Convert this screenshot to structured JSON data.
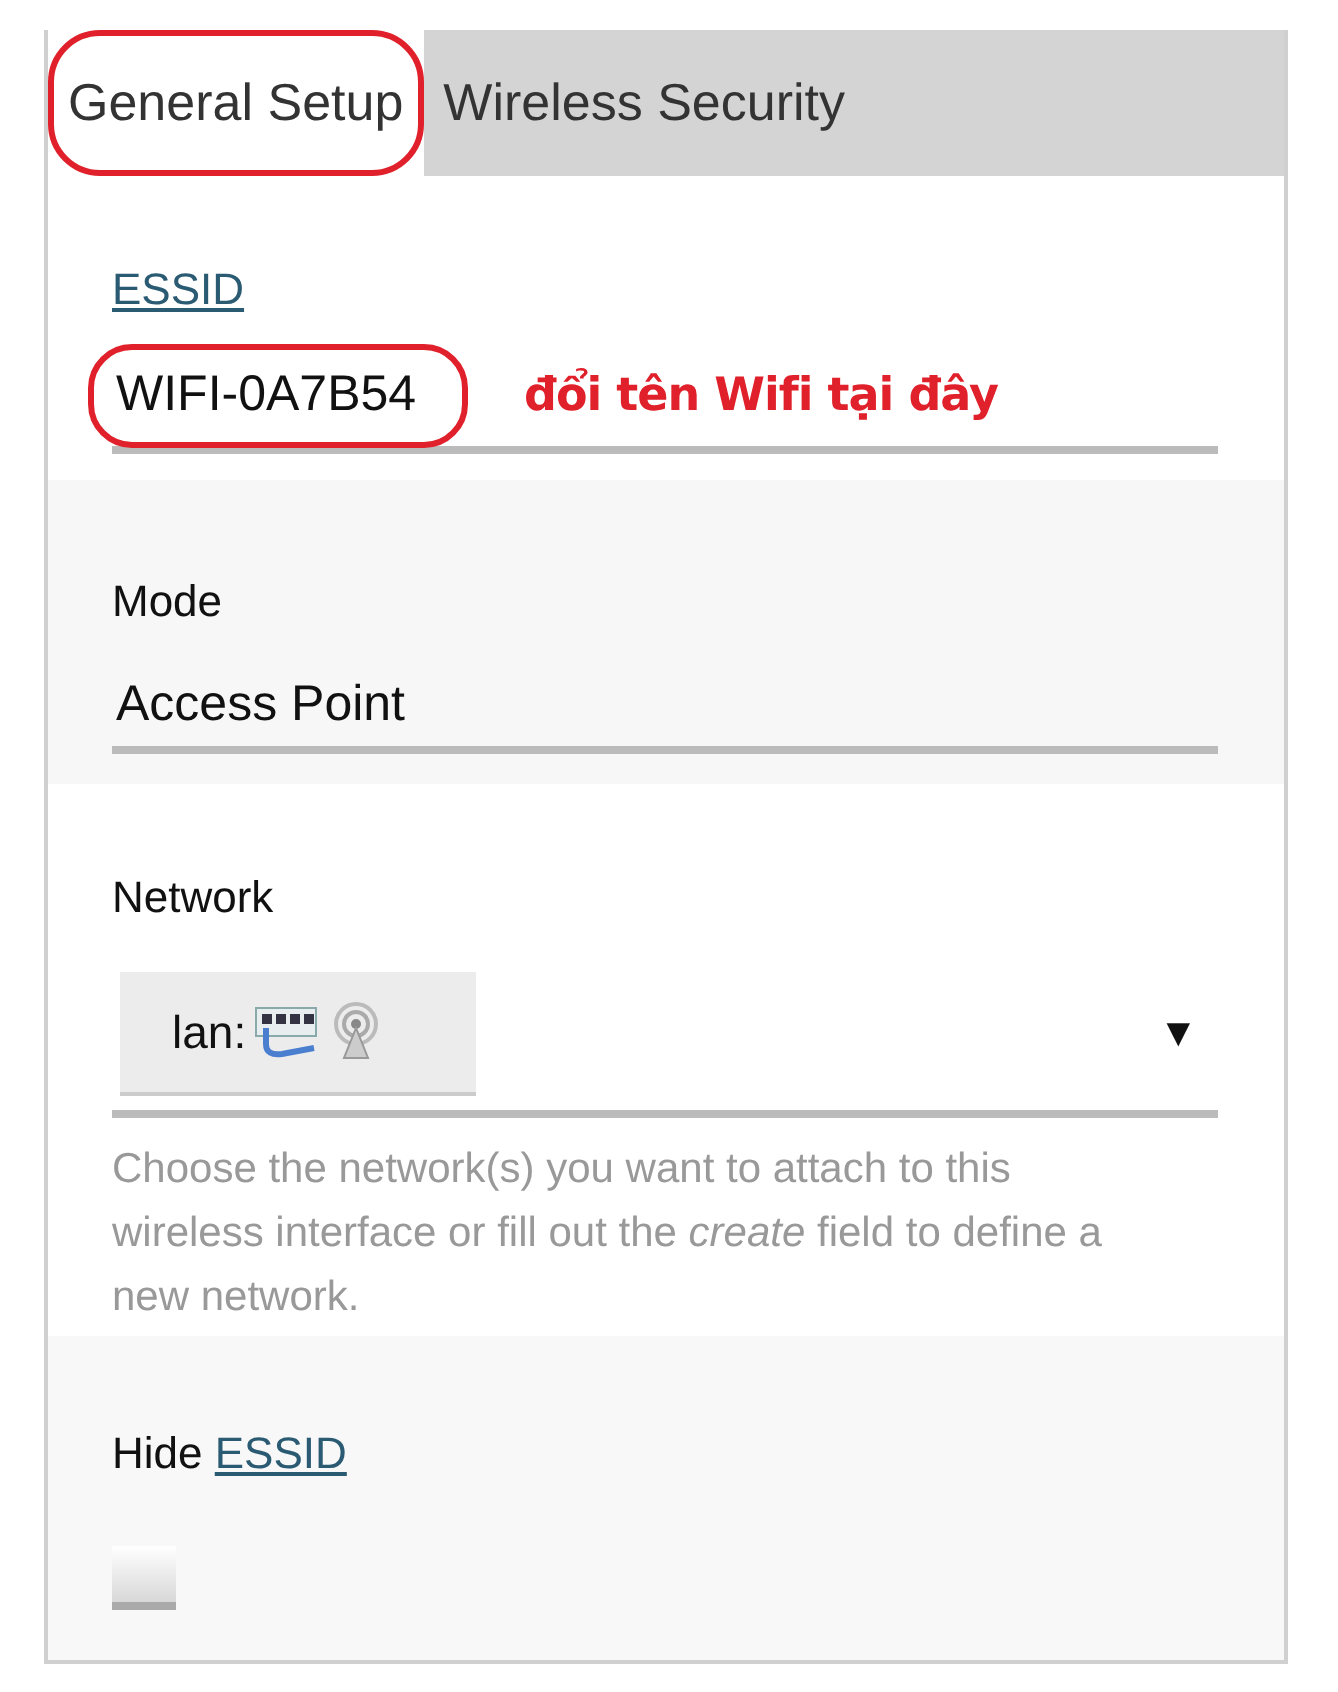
{
  "tabs": [
    {
      "label": "General Setup",
      "selected": true,
      "circled": true
    },
    {
      "label": "Wireless Security",
      "selected": false,
      "circled": false
    }
  ],
  "essid": {
    "label": "ESSID",
    "value": "WIFI-0A7B54",
    "circled": true,
    "note": "đổi tên Wifi tại đây"
  },
  "mode": {
    "label": "Mode",
    "value": "Access Point"
  },
  "network": {
    "label": "Network",
    "chip_label": "lan:",
    "arrow": "▼",
    "help": "Choose the network(s) you want to attach to this wireless interface or fill out the *create* field to define a new network."
  },
  "hide_essid": {
    "label": "Hide",
    "link": "ESSID",
    "checked": false
  }
}
